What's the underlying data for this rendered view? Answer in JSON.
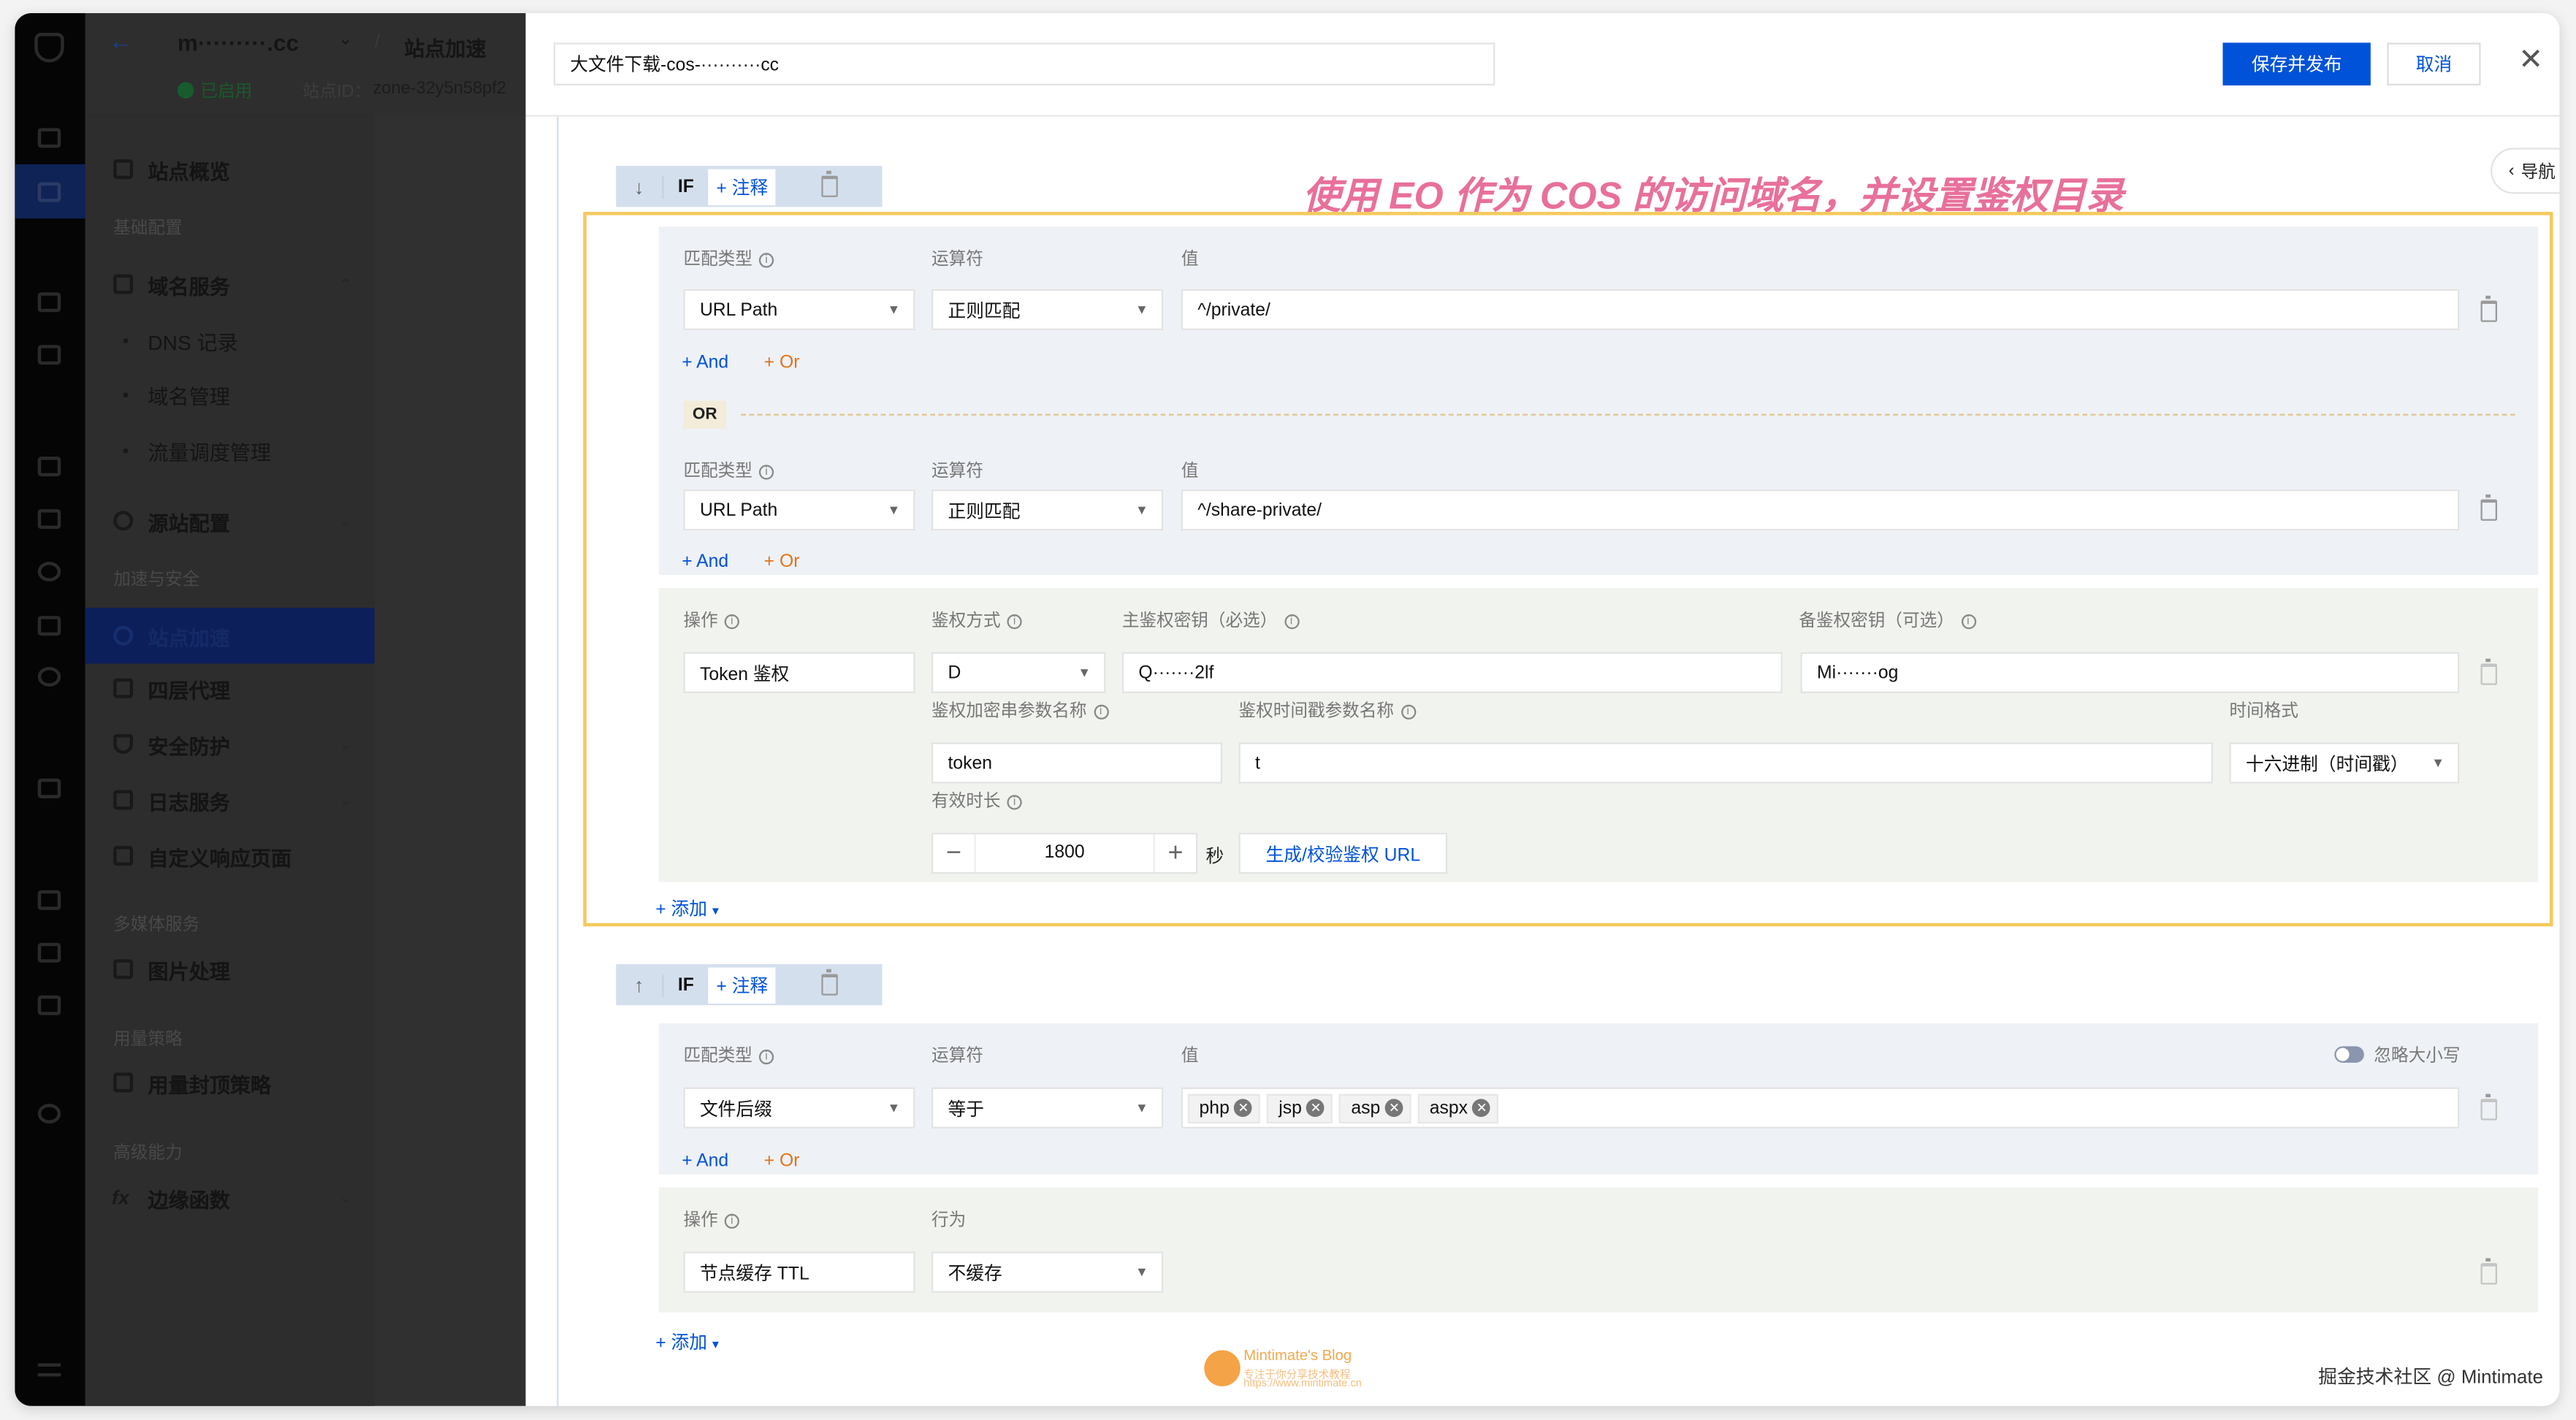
{
  "header": {
    "site_name": "m·········.cc",
    "separator": "/",
    "page": "站点加速",
    "status": "已启用",
    "site_id_label": "站点ID：",
    "site_id": "zone-32y5n58pf2"
  },
  "sidebar": {
    "items": [
      {
        "label": "站点概览"
      },
      {
        "group": "基础配置"
      },
      {
        "label": "域名服务"
      },
      {
        "label": "DNS 记录"
      },
      {
        "label": "域名管理"
      },
      {
        "label": "流量调度管理"
      },
      {
        "label": "源站配置"
      },
      {
        "group": "加速与安全"
      },
      {
        "label": "站点加速"
      },
      {
        "label": "四层代理"
      },
      {
        "label": "安全防护"
      },
      {
        "label": "日志服务"
      },
      {
        "label": "自定义响应页面"
      },
      {
        "group": "多媒体服务"
      },
      {
        "label": "图片处理"
      },
      {
        "group": "用量策略"
      },
      {
        "label": "用量封顶策略"
      },
      {
        "group": "高级能力"
      },
      {
        "label": "边缘函数"
      }
    ]
  },
  "drawer": {
    "rule_name": "大文件下载-cos-··········cc",
    "save_label": "保存并发布",
    "cancel_label": "取消",
    "nav_label": "导航",
    "annotation": "使用 EO 作为 COS 的访问域名，并设置鉴权目录",
    "if_label": "IF",
    "comment_label": "+ 注释",
    "and_label": "+ And",
    "or_label": "+ Or",
    "or_badge": "OR",
    "add_label": "+ 添加",
    "labels": {
      "match_type": "匹配类型",
      "operator": "运算符",
      "value": "值",
      "action": "操作",
      "behavior": "行为",
      "ignore_case": "忽略大小写"
    },
    "rule1": {
      "conditions": [
        {
          "match_type": "URL Path",
          "operator": "正则匹配",
          "value": "^/private/"
        },
        {
          "match_type": "URL Path",
          "operator": "正则匹配",
          "value": "^/share-private/"
        }
      ],
      "action": {
        "operation": "Token 鉴权",
        "auth_type_label": "鉴权方式",
        "auth_type": "D",
        "primary_key_label": "主鉴权密钥（必选）",
        "primary_key": "Q·······2lf",
        "backup_key_label": "备鉴权密钥（可选）",
        "backup_key": "Mi·······og",
        "sign_param_label": "鉴权加密串参数名称",
        "sign_param": "token",
        "time_param_label": "鉴权时间戳参数名称",
        "time_param": "t",
        "time_format_label": "时间格式",
        "time_format": "十六进制（时间戳）",
        "ttl_label": "有效时长",
        "ttl": "1800",
        "ttl_unit": "秒",
        "generate_label": "生成/校验鉴权 URL"
      }
    },
    "rule2": {
      "condition": {
        "match_type": "文件后缀",
        "operator": "等于",
        "values": [
          "php",
          "jsp",
          "asp",
          "aspx"
        ]
      },
      "action": {
        "operation": "节点缓存 TTL",
        "behavior": "不缓存"
      }
    }
  },
  "watermark": {
    "blog": "Mintimate's Blog",
    "slogan": "专注于你分享技术教程",
    "url": "https://www.mintimate.cn",
    "credit": "掘金技术社区 @ Mintimate"
  },
  "colors": {
    "primary": "#0052d9",
    "highlight_border": "#f5c95c",
    "annotation": "#e8709a"
  }
}
